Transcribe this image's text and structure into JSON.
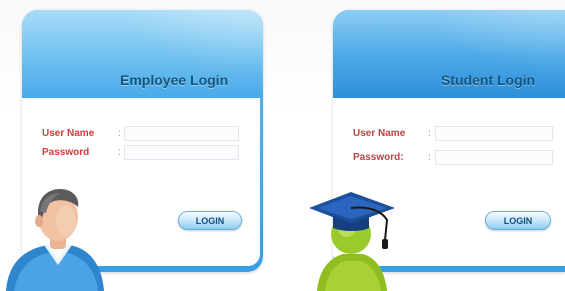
{
  "employee": {
    "title": "Employee Login",
    "username_label": "User Name",
    "password_label": "Password",
    "colon": ":",
    "username_value": "",
    "password_value": "",
    "login_label": "LOGIN",
    "avatar_icon": "employee-avatar-icon"
  },
  "student": {
    "title": "Student Login",
    "username_label": "User Name",
    "password_label": "Password:",
    "colon": ":",
    "username_value": "",
    "password_value": "",
    "login_label": "LOGIN",
    "avatar_icon": "student-graduate-avatar-icon"
  },
  "colors": {
    "panel_blue": "#4aa7e6",
    "header_light": "#a9dcf7",
    "title_text": "#16557f",
    "label_red": "#d63a3a",
    "button_text": "#124f7f"
  }
}
